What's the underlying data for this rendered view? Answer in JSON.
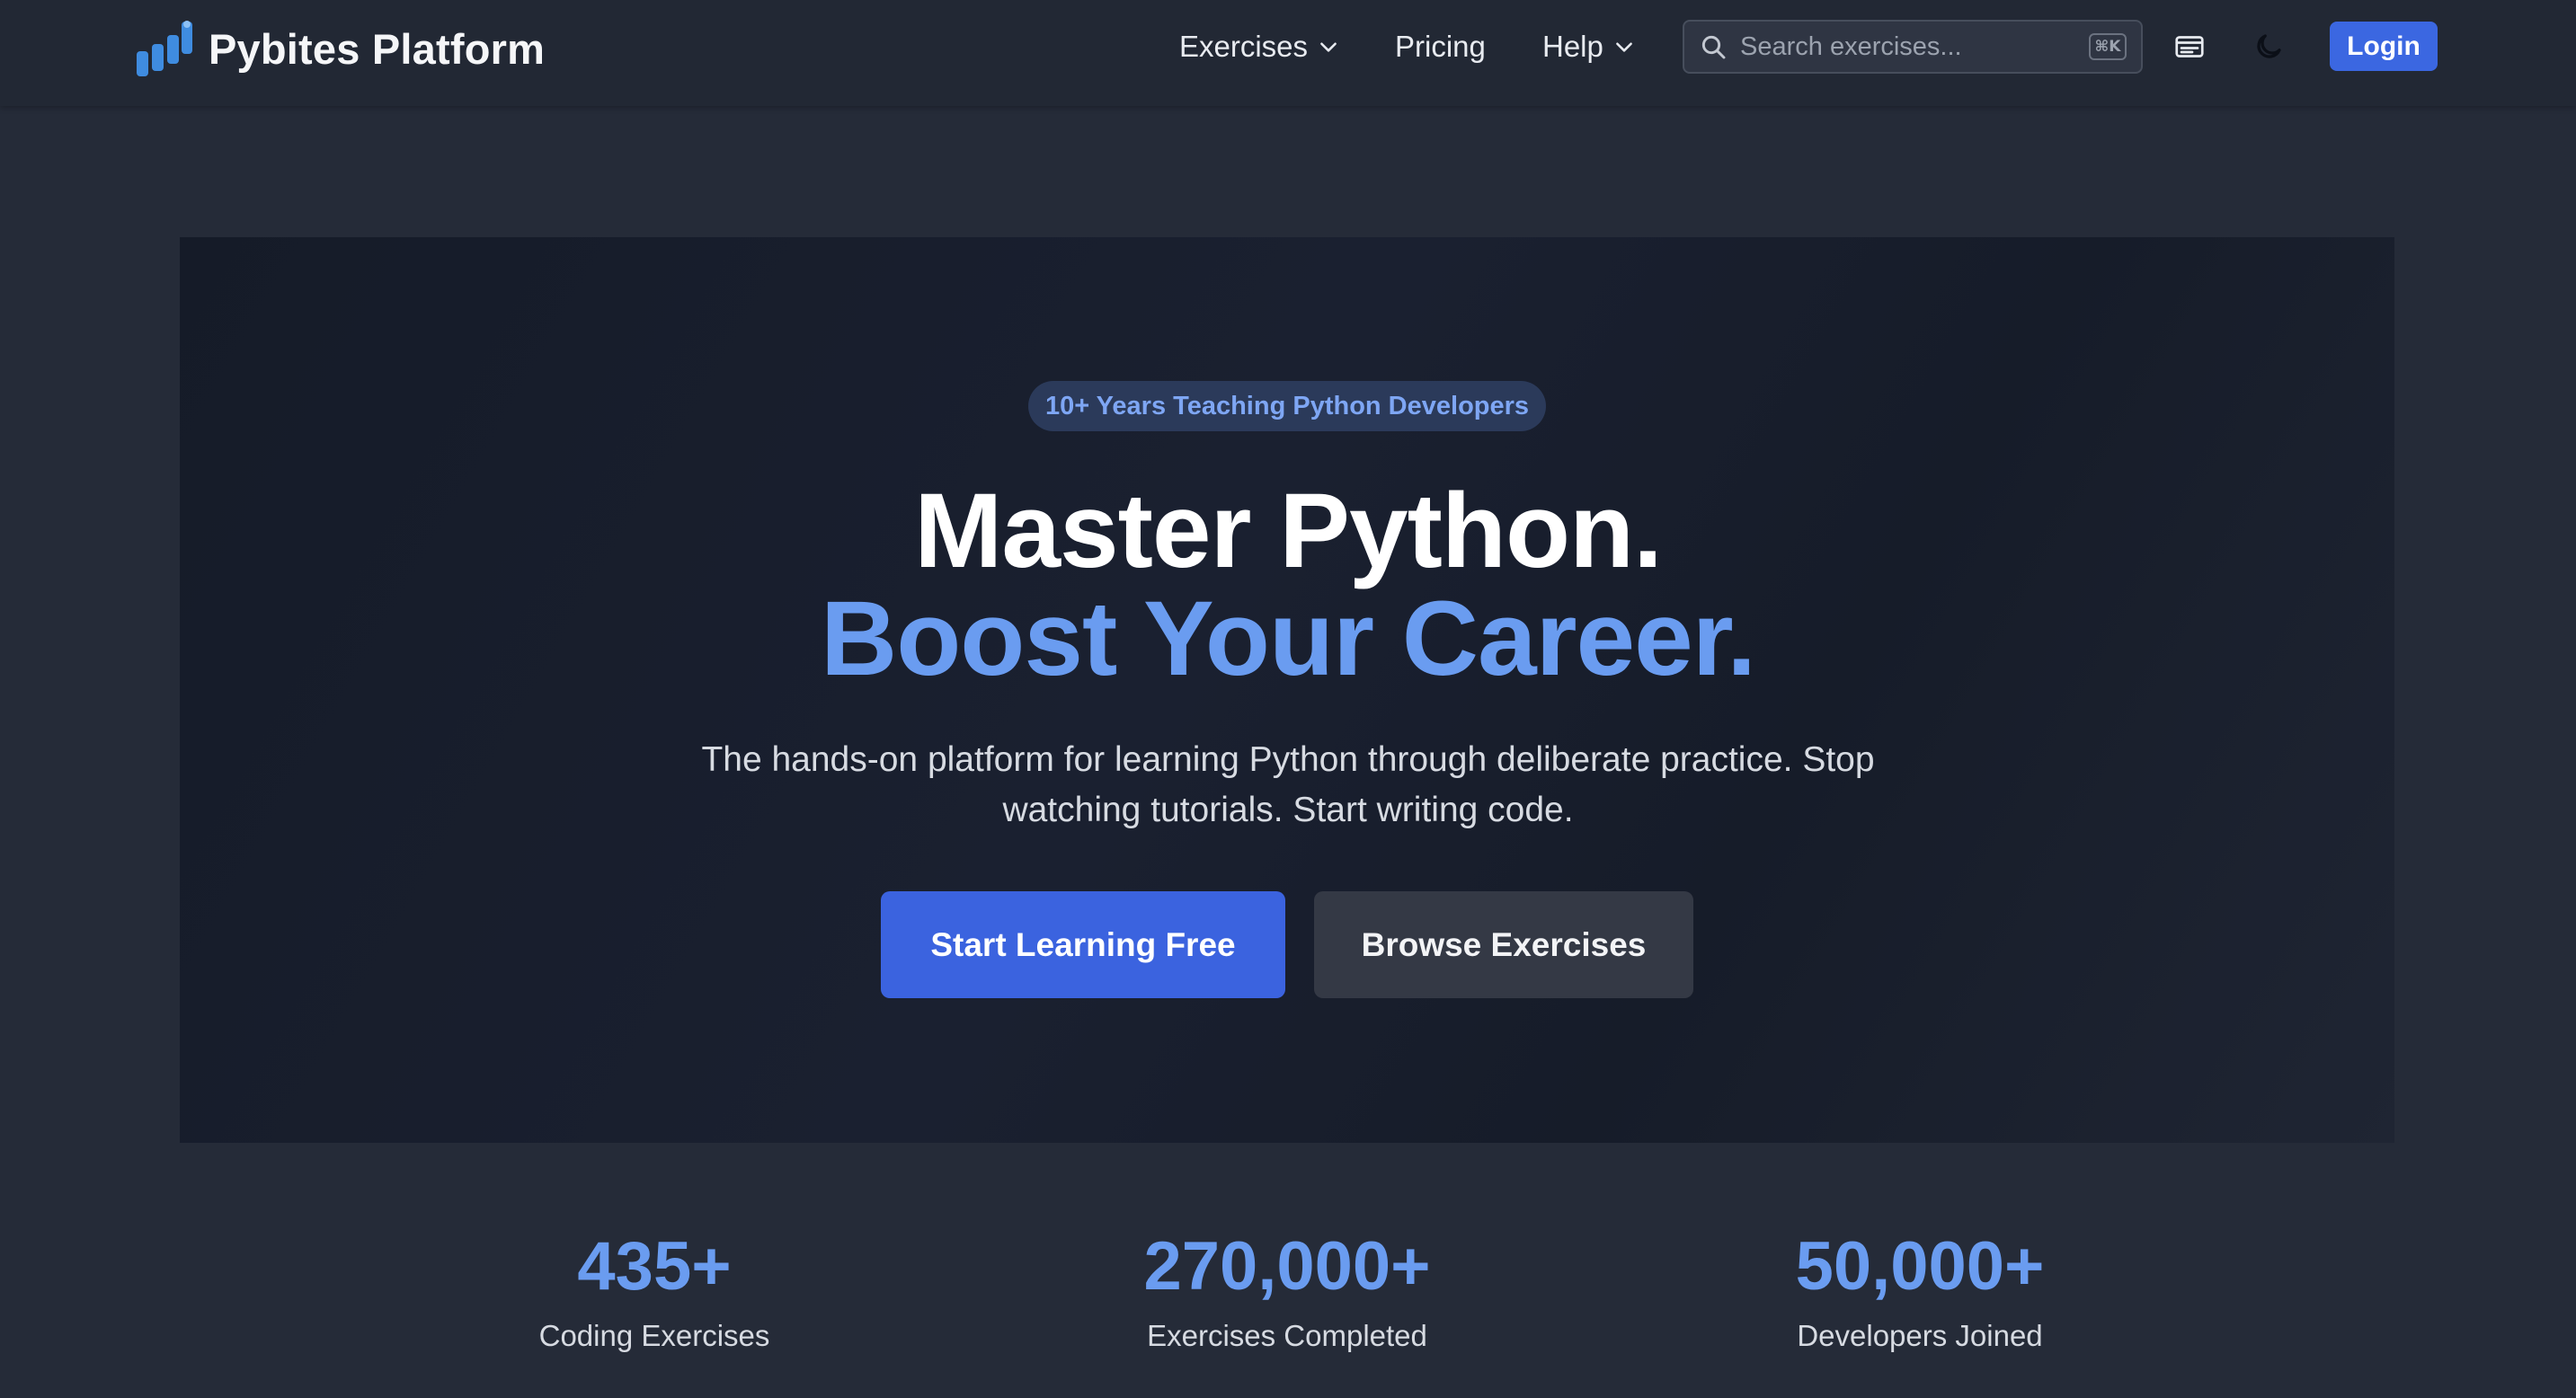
{
  "nav": {
    "brand": "Pybites Platform",
    "links": {
      "exercises": "Exercises",
      "pricing": "Pricing",
      "help": "Help"
    },
    "search": {
      "placeholder": "Search exercises...",
      "shortcut": "⌘K"
    },
    "login": "Login"
  },
  "hero": {
    "badge": "10+ Years Teaching Python Developers",
    "headline_line1": "Master Python.",
    "headline_line2": "Boost Your Career.",
    "subtitle": "The hands-on platform for learning Python through deliberate practice. Stop watching tutorials. Start writing code.",
    "cta_primary": "Start Learning Free",
    "cta_secondary": "Browse Exercises"
  },
  "stats": [
    {
      "value": "435+",
      "label": "Coding Exercises"
    },
    {
      "value": "270,000+",
      "label": "Exercises Completed"
    },
    {
      "value": "50,000+",
      "label": "Developers Joined"
    }
  ],
  "colors": {
    "accent": "#3b63df",
    "highlight": "#6a9cf0",
    "background": "#252b38"
  },
  "icons": [
    "pybites-logo-icon",
    "chevron-down-icon",
    "search-icon",
    "terminal-icon",
    "moon-icon"
  ]
}
